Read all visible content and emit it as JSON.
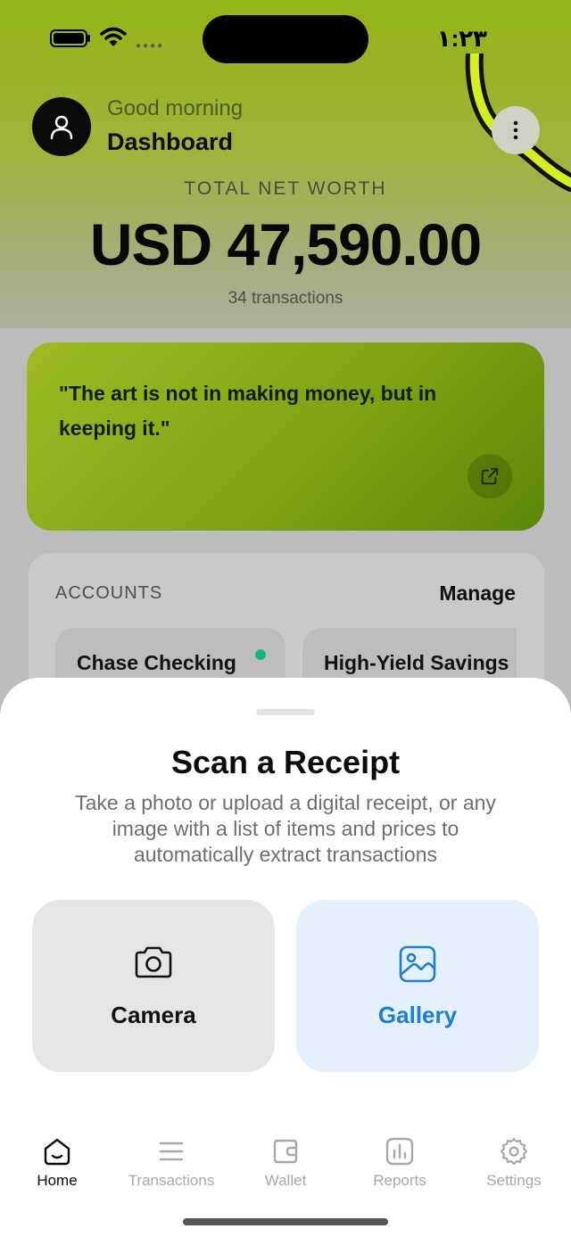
{
  "status_bar": {
    "time": "١:٢٣"
  },
  "header": {
    "greeting": "Good morning",
    "title": "Dashboard",
    "net_worth_label": "TOTAL NET WORTH",
    "net_worth_value": "USD 47,590.00",
    "transactions_count": "34 transactions"
  },
  "quote": {
    "text": "\"The art is not in making money, but in keeping it.\""
  },
  "accounts": {
    "label": "ACCOUNTS",
    "manage_label": "Manage",
    "items": [
      {
        "name": "Chase Checking",
        "active": true
      },
      {
        "name": "High-Yield Savings"
      }
    ]
  },
  "scan_sheet": {
    "title": "Scan a Receipt",
    "description": "Take a photo or upload a digital receipt, or any image with a list of items and prices to automatically extract transactions",
    "camera_label": "Camera",
    "gallery_label": "Gallery"
  },
  "tab_bar": {
    "items": [
      {
        "label": "Home",
        "icon": "home-icon",
        "active": true
      },
      {
        "label": "Transactions",
        "icon": "list-icon"
      },
      {
        "label": "Wallet",
        "icon": "wallet-icon"
      },
      {
        "label": "Reports",
        "icon": "chart-icon"
      },
      {
        "label": "Settings",
        "icon": "gear-icon"
      }
    ]
  },
  "colors": {
    "brand_green": "#93b516",
    "gallery_blue": "#1a7fd6",
    "status_dot": "#10b981"
  }
}
